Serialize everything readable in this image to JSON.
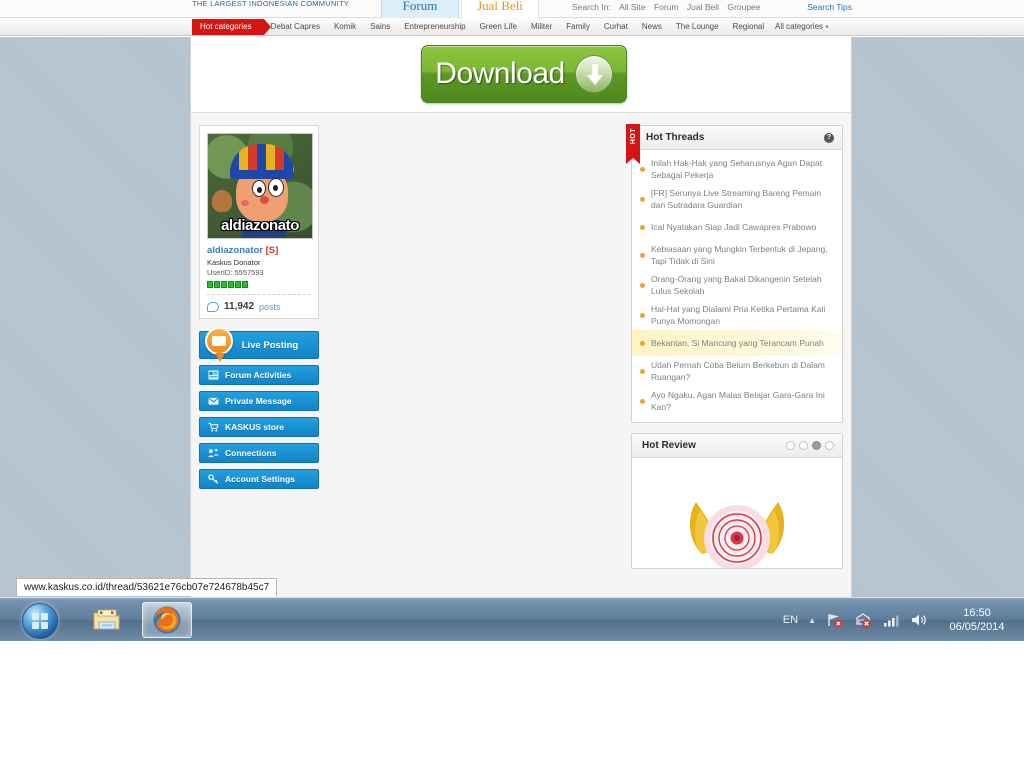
{
  "browser": {
    "status_url": "www.kaskus.co.id/thread/53621e76cb07e724678b45c7"
  },
  "site": {
    "logo_tagline": "THE LARGEST INDONESIAN COMMUNITY",
    "tabs": [
      {
        "label": "Forum",
        "active": true
      },
      {
        "label": "Jual Beli",
        "active": false
      }
    ],
    "search": {
      "label": "Search In:",
      "scopes": [
        "All Site",
        "Forum",
        "Jual Beli",
        "Groupee"
      ],
      "tips_label": "Search Tips"
    },
    "categories": {
      "hot_label": "Hot categories",
      "items": [
        "Debat Capres",
        "Komik",
        "Sains",
        "Entrepreneurship",
        "Green Life",
        "Militer",
        "Family",
        "Curhat",
        "News",
        "The Lounge",
        "Regional"
      ],
      "all_label": "All categories"
    }
  },
  "ad": {
    "download_label": "Download",
    "arrow_icon": "download-arrow-icon"
  },
  "profile": {
    "avatar_caption": "aldiazonato",
    "username": "aldiazonator",
    "username_badge": "[S]",
    "title": "Kaskus Donator",
    "userid_label": "UserID: 5557593",
    "reputation_blocks": 6,
    "post_count": "11,942",
    "post_word": "posts",
    "buttons": [
      {
        "label": "Live Posting",
        "icon": "live-posting-icon"
      },
      {
        "label": "Forum Activities",
        "icon": "forum-activities-icon"
      },
      {
        "label": "Private Message",
        "icon": "envelope-icon"
      },
      {
        "label": "KASKUS store",
        "icon": "cart-icon"
      },
      {
        "label": "Connections",
        "icon": "connections-icon"
      },
      {
        "label": "Account Settings",
        "icon": "key-icon"
      }
    ]
  },
  "hot_threads": {
    "ribbon_label": "HOT",
    "title": "Hot Threads",
    "help_icon": "help-icon",
    "items": [
      {
        "text": "Inilah Hak-Hak yang Seharusnya Agan Dapat Sebagai Pekerja",
        "highlighted": false
      },
      {
        "text": "[FR] Serunya Live Streaming Bareng Pemain dan Sutradara Guardian",
        "highlighted": false
      },
      {
        "text": "Ical Nyatakan Siap Jadi Cawapres Prabowo",
        "highlighted": false
      },
      {
        "text": "Kebiasaan yang Mungkin Terbentuk di Jepang, Tapi Tidak di Sini",
        "highlighted": false
      },
      {
        "text": "Orang-Orang yang Bakal Dikangenin Setelah Lulus Sekolah",
        "highlighted": false
      },
      {
        "text": "Hal-Hal yang Dialami Pria Ketika Pertama Kali Punya Momongan",
        "highlighted": false
      },
      {
        "text": "Bekantan, Si Mancung yang Terancam Punah",
        "highlighted": true
      },
      {
        "text": "Udah Pernah Coba Belum Berkebun di Dalam Ruangan?",
        "highlighted": false
      },
      {
        "text": "Ayo Ngaku, Agan Malas Belajar Gara-Gara Ini Kan?",
        "highlighted": false
      }
    ]
  },
  "hot_review": {
    "title": "Hot Review",
    "dots": 4,
    "active_dot": 3,
    "image_alt": "pink-flower-photo"
  },
  "taskbar": {
    "start_icon": "windows-start-icon",
    "items": [
      {
        "icon": "file-explorer-icon",
        "active": false
      },
      {
        "icon": "firefox-icon",
        "active": true
      }
    ],
    "tray": {
      "language": "EN",
      "caret_icon": "chevron-up-icon",
      "icons": [
        "network-error-icon",
        "action-center-error-icon",
        "signal-bars-icon",
        "volume-icon"
      ],
      "time": "16:50",
      "date": "06/05/2014"
    }
  },
  "colors": {
    "accent_red": "#d61414",
    "accent_blue": "#1283c8",
    "accent_orange": "#f08a1c",
    "download_green": "#7cb734",
    "page_bg": "#b3c2cc",
    "highlight_yellow": "#fdf3c4"
  }
}
